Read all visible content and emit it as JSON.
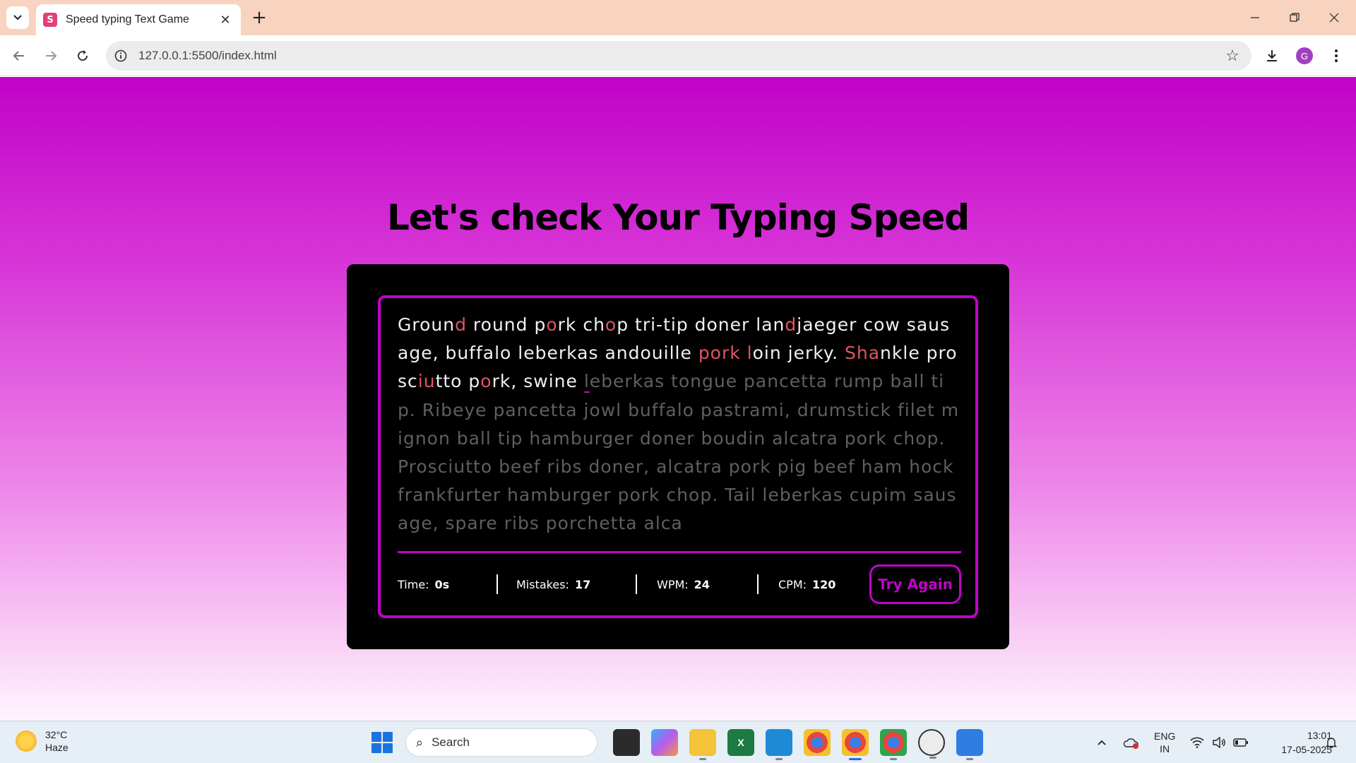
{
  "browser": {
    "tab_title": "Speed typing Text Game",
    "favicon_letter": "S",
    "url": "127.0.0.1:5500/index.html",
    "profile_letter": "G"
  },
  "page": {
    "heading": "Let's check Your Typing Speed",
    "typing_segments": [
      {
        "t": "Groun",
        "s": "ok"
      },
      {
        "t": "d",
        "s": "err"
      },
      {
        "t": " round p",
        "s": "ok"
      },
      {
        "t": "o",
        "s": "err"
      },
      {
        "t": "rk ch",
        "s": "ok"
      },
      {
        "t": "o",
        "s": "err"
      },
      {
        "t": "p tri-tip doner lan",
        "s": "ok"
      },
      {
        "t": "d",
        "s": "err"
      },
      {
        "t": "jaeger cow sausage, buffalo leberkas andouille ",
        "s": "ok"
      },
      {
        "t": "pork l",
        "s": "err"
      },
      {
        "t": "oin jerky. ",
        "s": "ok"
      },
      {
        "t": "Sha",
        "s": "err"
      },
      {
        "t": "nkle prosc",
        "s": "ok"
      },
      {
        "t": "iu",
        "s": "err"
      },
      {
        "t": "tto p",
        "s": "ok"
      },
      {
        "t": "o",
        "s": "err"
      },
      {
        "t": "rk, swine ",
        "s": "ok"
      },
      {
        "t": "l",
        "s": "cur"
      },
      {
        "t": "eberkas tongue pancetta rump ball tip. Ribeye pancetta jowl buffalo pastrami, drumstick filet mignon ball tip hamburger doner boudin alcatra pork chop. Prosciutto beef ribs doner, alcatra pork pig beef ham hock frankfurter hamburger pork chop. Tail leberkas cupim sausage, spare ribs porchetta alca",
        "s": "pending"
      }
    ],
    "stats": {
      "time_label": "Time:",
      "time_value": "0s",
      "mistakes_label": "Mistakes:",
      "mistakes_value": "17",
      "wpm_label": "WPM:",
      "wpm_value": "24",
      "cpm_label": "CPM:",
      "cpm_value": "120"
    },
    "try_again_label": "Try Again",
    "colors": {
      "accent": "#c003c8",
      "typed": "#f1f1f1",
      "error": "#e05461",
      "pending": "#5f5f5f"
    }
  },
  "taskbar": {
    "weather_temp": "32°C",
    "weather_desc": "Haze",
    "search_label": "Search",
    "lang_line1": "ENG",
    "lang_line2": "IN",
    "time": "13:01",
    "date": "17-05-2025"
  }
}
